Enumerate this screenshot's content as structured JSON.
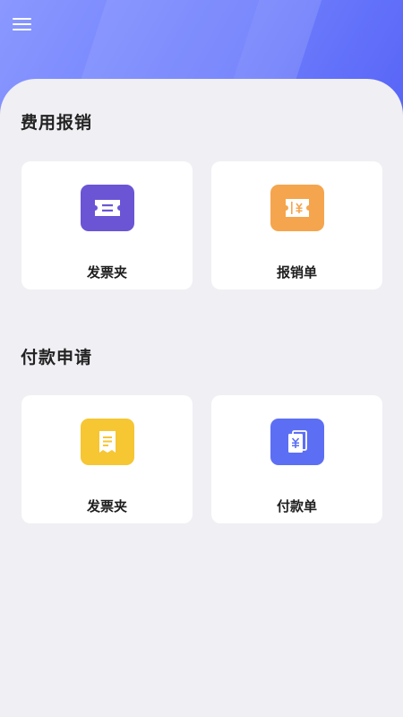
{
  "header": {
    "menu_icon": "hamburger-menu-icon"
  },
  "sections": [
    {
      "title": "费用报销",
      "cards": [
        {
          "label": "发票夹",
          "icon": "ticket-icon",
          "color": "#6b55d5"
        },
        {
          "label": "报销单",
          "icon": "yuan-ticket-icon",
          "color": "#f5a54d"
        }
      ]
    },
    {
      "title": "付款申请",
      "cards": [
        {
          "label": "发票夹",
          "icon": "receipt-icon",
          "color": "#f6c633"
        },
        {
          "label": "付款单",
          "icon": "yuan-document-icon",
          "color": "#5c6ff4"
        }
      ]
    }
  ],
  "colors": {
    "header_gradient_start": "#8a98ff",
    "header_gradient_end": "#5663f7",
    "background": "#efeff4",
    "card": "#ffffff"
  }
}
